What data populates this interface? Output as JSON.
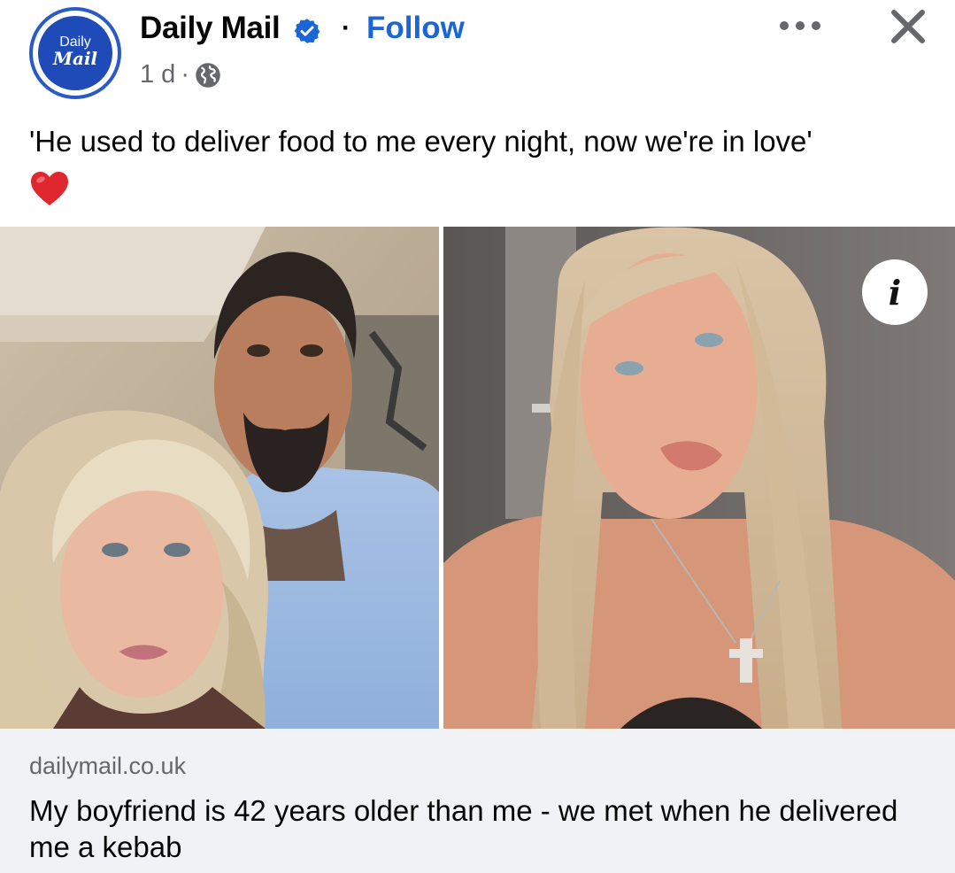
{
  "post": {
    "page_name": "Daily Mail",
    "avatar_text_top": "Daily",
    "avatar_text_bottom": "Mail",
    "follow_label": "Follow",
    "separator": "·",
    "timestamp": "1 d",
    "meta_separator": "·",
    "privacy_icon": "globe-icon",
    "more_icon": "more-options-icon",
    "close_icon": "close-icon",
    "verified_icon": "verified-badge-icon",
    "caption": "'He used to deliver food to me every night, now we're in love'",
    "emoji": "red-heart",
    "info_icon_label": "i"
  },
  "link_preview": {
    "domain": "dailymail.co.uk",
    "headline": "My boyfriend is 42 years older than me - we met when he delivered me a kebab"
  },
  "colors": {
    "brand_blue": "#1f4bb8",
    "follow_blue": "#1b66d6",
    "meta_gray": "#65676b",
    "card_bg": "#f0f2f5",
    "heart_red": "#e0262f"
  }
}
